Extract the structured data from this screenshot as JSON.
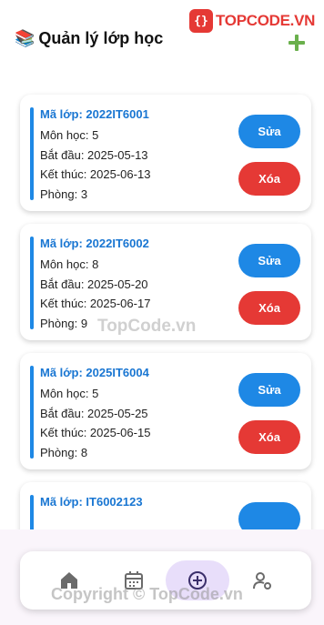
{
  "header": {
    "icon": "books-icon",
    "title": "Quản lý lớp học",
    "add_icon": "plus-icon",
    "add_color": "#6ab04c"
  },
  "logo": {
    "mark": "{}",
    "text": "TOPCODE.VN"
  },
  "classes": [
    {
      "code": "Mã lớp: 2022IT6001",
      "subject": "Môn học: 5",
      "start": "Bắt đầu: 2025-05-13",
      "end": "Kết thúc: 2025-06-13",
      "room": "Phòng: 3"
    },
    {
      "code": "Mã lớp: 2022IT6002",
      "subject": "Môn học: 8",
      "start": "Bắt đầu: 2025-05-20",
      "end": "Kết thúc: 2025-06-17",
      "room": "Phòng: 9"
    },
    {
      "code": "Mã lớp: 2025IT6004",
      "subject": "Môn học: 5",
      "start": "Bắt đầu: 2025-05-25",
      "end": "Kết thúc: 2025-06-15",
      "room": "Phòng: 8"
    },
    {
      "code": "Mã lớp: IT6002123"
    }
  ],
  "actions": {
    "edit": "Sửa",
    "delete": "Xóa"
  },
  "colors": {
    "accent": "#1e88e5",
    "danger": "#e53935",
    "nav_active_bg": "#e8defa"
  },
  "nav": [
    {
      "icon": "home-icon"
    },
    {
      "icon": "calendar-icon"
    },
    {
      "icon": "add-circle-icon",
      "active": true
    },
    {
      "icon": "user-settings-icon"
    }
  ],
  "watermark": "TopCode.vn",
  "copyright": "Copyright © TopCode.vn"
}
